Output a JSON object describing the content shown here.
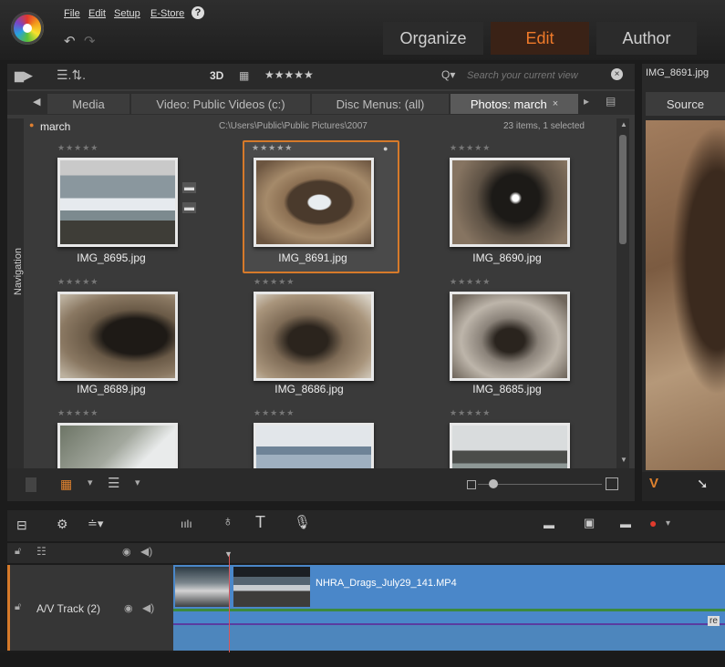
{
  "menu": {
    "file": "File",
    "edit": "Edit",
    "setup": "Setup",
    "estore": "E-Store",
    "help": "?"
  },
  "modes": {
    "organize": "Organize",
    "edit": "Edit",
    "author": "Author"
  },
  "library": {
    "toolbar": {
      "view3d": "3D",
      "rating": "★★★★★",
      "search_placeholder": "Search your current view"
    },
    "tabs": [
      "Media",
      "Video: Public Videos (c:)",
      "Disc Menus: (all)",
      "Photos: march"
    ],
    "folder": "march",
    "path": "C:\\Users\\Public\\Public Pictures\\2007",
    "status": "23 items, 1 selected",
    "navigation_label": "Navigation",
    "photos": [
      {
        "name": "IMG_8695.jpg",
        "stars": "★★★★★"
      },
      {
        "name": "IMG_8691.jpg",
        "stars": "★★★★★"
      },
      {
        "name": "IMG_8690.jpg",
        "stars": "★★★★★"
      },
      {
        "name": "IMG_8689.jpg",
        "stars": "★★★★★"
      },
      {
        "name": "IMG_8686.jpg",
        "stars": "★★★★★"
      },
      {
        "name": "IMG_8685.jpg",
        "stars": "★★★★★"
      },
      {
        "name": "",
        "stars": "★★★★★"
      },
      {
        "name": "",
        "stars": "★★★★★"
      },
      {
        "name": "",
        "stars": "★★★★★"
      }
    ]
  },
  "preview": {
    "title": "IMG_8691.jpg",
    "source_label": "Source"
  },
  "timeline": {
    "track_label": "A/V Track (2)",
    "clip_name": "NHRA_Drags_July29_141.MP4",
    "clip_tag": "re"
  },
  "colors": {
    "accent": "#d67a2a",
    "clip": "#4a87c9"
  }
}
